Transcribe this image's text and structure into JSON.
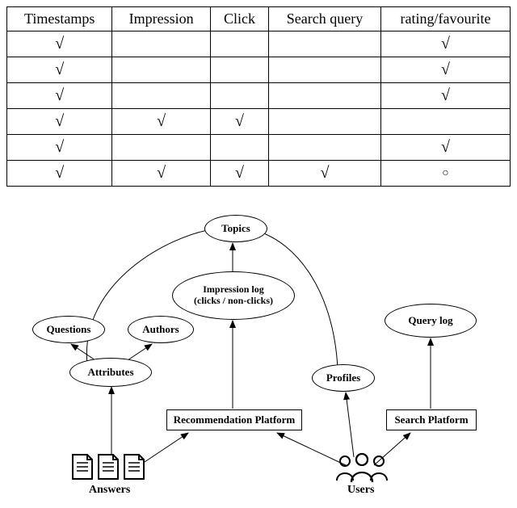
{
  "table": {
    "headers": [
      "Timestamps",
      "Impression",
      "Click",
      "Search query",
      "rating/favourite"
    ],
    "rows": [
      [
        "check",
        "",
        "",
        "",
        "check"
      ],
      [
        "check",
        "",
        "",
        "",
        "check"
      ],
      [
        "check",
        "",
        "",
        "",
        "check"
      ],
      [
        "check",
        "check",
        "check",
        "",
        ""
      ],
      [
        "check",
        "",
        "",
        "",
        "check"
      ],
      [
        "check",
        "check",
        "check",
        "check",
        "circ"
      ]
    ],
    "symbols": {
      "check": "√",
      "circ": "○"
    }
  },
  "diagram": {
    "nodes": {
      "topics": "Topics",
      "impression_log": "Impression log\n(clicks / non-clicks)",
      "query_log": "Query log",
      "questions": "Questions",
      "authors": "Authors",
      "attributes": "Attributes",
      "profiles": "Profiles",
      "recommendation_platform": "Recommendation Platform",
      "search_platform": "Search Platform",
      "answers_label": "Answers",
      "users_label": "Users"
    }
  }
}
